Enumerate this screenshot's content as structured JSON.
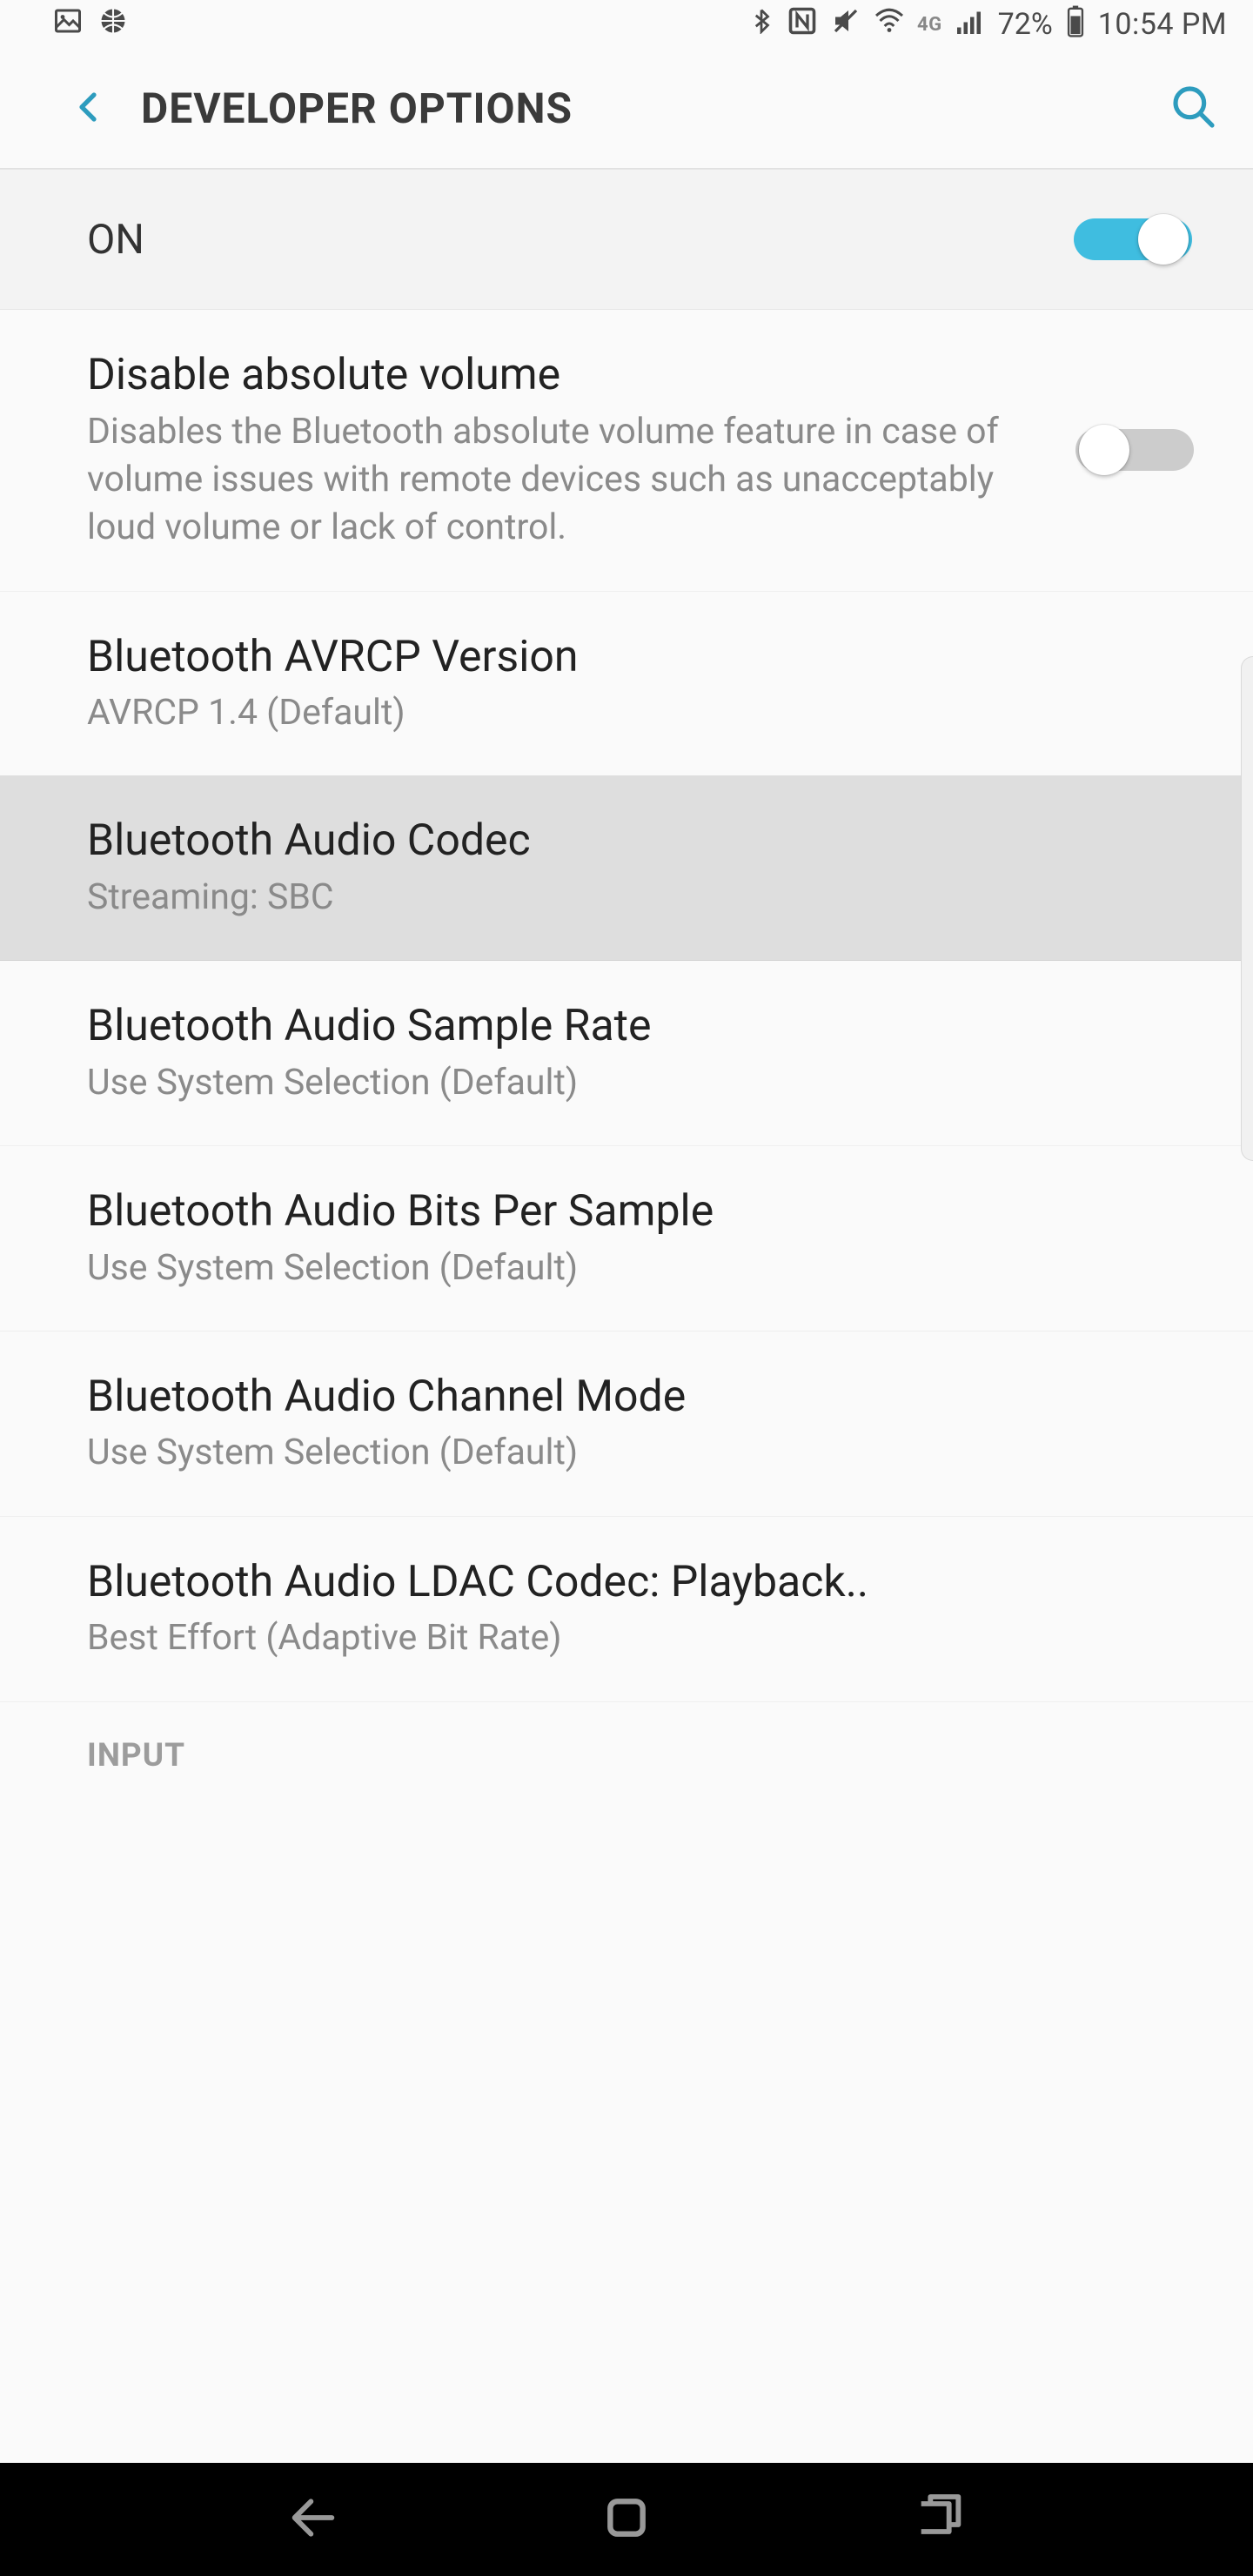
{
  "status": {
    "battery_pct": "72%",
    "time": "10:54 PM",
    "network_label": "4G"
  },
  "header": {
    "title": "DEVELOPER OPTIONS"
  },
  "master": {
    "label": "ON",
    "enabled": true
  },
  "settings": [
    {
      "title": "Disable absolute volume",
      "subtitle": "Disables the Bluetooth absolute volume feature in case of volume issues with remote devices such as unacceptably loud volume or lack of control.",
      "has_toggle": true,
      "toggle_on": false,
      "highlighted": false
    },
    {
      "title": "Bluetooth AVRCP Version",
      "subtitle": "AVRCP 1.4 (Default)",
      "has_toggle": false,
      "highlighted": false
    },
    {
      "title": "Bluetooth Audio Codec",
      "subtitle": "Streaming: SBC",
      "has_toggle": false,
      "highlighted": true
    },
    {
      "title": "Bluetooth Audio Sample Rate",
      "subtitle": "Use System Selection (Default)",
      "has_toggle": false,
      "highlighted": false
    },
    {
      "title": "Bluetooth Audio Bits Per Sample",
      "subtitle": "Use System Selection (Default)",
      "has_toggle": false,
      "highlighted": false
    },
    {
      "title": "Bluetooth Audio Channel Mode",
      "subtitle": "Use System Selection (Default)",
      "has_toggle": false,
      "highlighted": false
    },
    {
      "title": "Bluetooth Audio LDAC Codec: Playback..",
      "subtitle": "Best Effort (Adaptive Bit Rate)",
      "has_toggle": false,
      "highlighted": false
    }
  ],
  "section_header": "INPUT"
}
